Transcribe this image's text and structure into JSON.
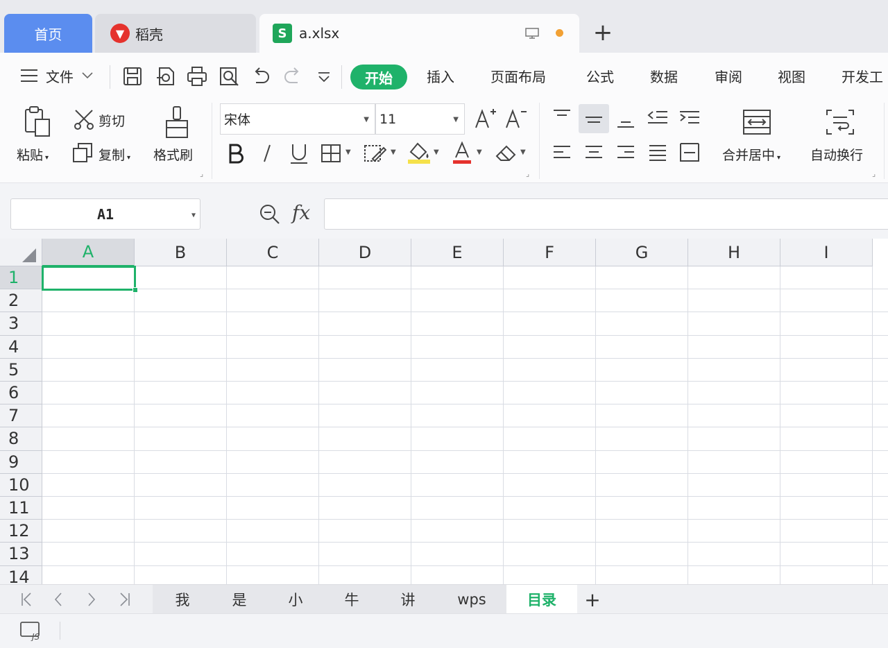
{
  "tabs": {
    "home": "首页",
    "daoke": "稻壳",
    "file": "a.xlsx",
    "add": "+"
  },
  "menu": {
    "file": "文件",
    "items": [
      "开始",
      "插入",
      "页面布局",
      "公式",
      "数据",
      "审阅",
      "视图",
      "开发工"
    ]
  },
  "ribbon": {
    "paste": "粘贴",
    "cut": "剪切",
    "copy": "复制",
    "format_painter": "格式刷",
    "font_name": "宋体",
    "font_size": "11",
    "merge_center": "合并居中",
    "wrap_text": "自动换行"
  },
  "formula_bar": {
    "cell_ref": "A1",
    "fx": "fx",
    "value": ""
  },
  "grid": {
    "columns": [
      "A",
      "B",
      "C",
      "D",
      "E",
      "F",
      "G",
      "H",
      "I"
    ],
    "rows": [
      "1",
      "2",
      "3",
      "4",
      "5",
      "6",
      "7",
      "8",
      "9",
      "10",
      "11",
      "12",
      "13",
      "14"
    ],
    "selected_column": "A",
    "selected_row": "1"
  },
  "sheets": {
    "tabs": [
      "我",
      "是",
      "小",
      "牛",
      "讲",
      "wps",
      "目录"
    ],
    "active": "目录",
    "add": "+"
  },
  "colors": {
    "accent_green": "#1fb26a",
    "home_tab_blue": "#5b8def",
    "unsaved_dot": "#f2a134",
    "font_color_red": "#e5322d",
    "highlight_yellow": "#f5e14a"
  },
  "icons": [
    "menu-icon",
    "save-icon",
    "export-icon",
    "print-icon",
    "print-preview-icon",
    "undo-icon",
    "redo-icon",
    "more-icon",
    "paste-icon",
    "cut-icon",
    "copy-icon",
    "format-painter-icon",
    "bold-icon",
    "italic-icon",
    "underline-icon",
    "border-icon",
    "cell-style-icon",
    "fill-color-icon",
    "font-color-icon",
    "clear-icon",
    "align-top-icon",
    "align-middle-icon",
    "align-bottom-icon",
    "indent-decrease-icon",
    "indent-increase-icon",
    "align-left-icon",
    "align-center-icon",
    "align-right-icon",
    "justify-icon",
    "distributed-icon",
    "merge-icon",
    "wrap-icon",
    "zoom-icon",
    "js-macro-icon"
  ]
}
